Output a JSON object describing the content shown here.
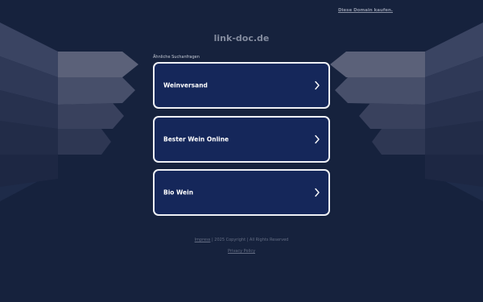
{
  "header": {
    "domain_offer_link": "Diese Domain kaufen.",
    "site_title": "link-doc.de"
  },
  "main": {
    "related_label": "Ähnliche Suchanfragen",
    "results": [
      {
        "label": "Weinversand",
        "icon": "chevron-right-icon"
      },
      {
        "label": "Bester Wein Online",
        "icon": "chevron-right-icon"
      },
      {
        "label": "Bio Wein",
        "icon": "chevron-right-icon"
      }
    ]
  },
  "footer": {
    "imprint_link": "Impress",
    "copyright": "| 2025 Copyright | All Rights Reserved",
    "privacy_link": "Privacy Policy"
  },
  "colors": {
    "background": "#16223d",
    "card_background": "#15275a",
    "card_border": "#eef0f5"
  }
}
